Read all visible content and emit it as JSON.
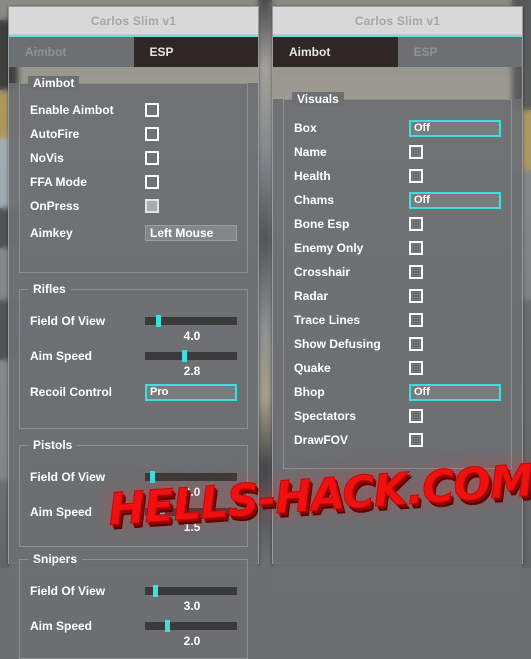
{
  "window_title": "Carlos Slim v1",
  "accent_color": "#3ddede",
  "watermark": "HELLS-HACK.COM",
  "left_window": {
    "title": "Carlos Slim v1",
    "tabs": [
      {
        "label": "Aimbot",
        "active": false
      },
      {
        "label": "ESP",
        "active": true
      }
    ],
    "groups": [
      {
        "legend": "Aimbot",
        "rows": [
          {
            "label": "Enable Aimbot",
            "type": "checkbox",
            "checked": false
          },
          {
            "label": "AutoFire",
            "type": "checkbox",
            "checked": false
          },
          {
            "label": "NoVis",
            "type": "checkbox",
            "checked": false
          },
          {
            "label": "FFA Mode",
            "type": "checkbox",
            "checked": false
          },
          {
            "label": "OnPress",
            "type": "checkbox",
            "checked": true
          },
          {
            "label": "Aimkey",
            "type": "combo-plain",
            "value": "Left Mouse"
          }
        ]
      },
      {
        "legend": "Rifles",
        "rows": [
          {
            "label": "Field Of View",
            "type": "slider",
            "value": "4.0",
            "percent": 12
          },
          {
            "label": "Aim Speed",
            "type": "slider",
            "value": "2.8",
            "percent": 40
          },
          {
            "label": "Recoil Control",
            "type": "combo",
            "value": "Pro"
          }
        ]
      },
      {
        "legend": "Pistols",
        "rows": [
          {
            "label": "Field Of View",
            "type": "slider",
            "value": "2.0",
            "percent": 5
          },
          {
            "label": "Aim Speed",
            "type": "slider",
            "value": "1.5",
            "percent": 16
          }
        ]
      },
      {
        "legend": "Snipers",
        "rows": [
          {
            "label": "Field Of View",
            "type": "slider",
            "value": "3.0",
            "percent": 9
          },
          {
            "label": "Aim Speed",
            "type": "slider",
            "value": "2.0",
            "percent": 22
          }
        ]
      }
    ]
  },
  "right_window": {
    "title": "Carlos Slim v1",
    "tabs": [
      {
        "label": "Aimbot",
        "active": true
      },
      {
        "label": "ESP",
        "active": false
      }
    ],
    "groups": [
      {
        "legend": "Visuals",
        "rows": [
          {
            "label": "Box",
            "type": "combo",
            "value": "Off"
          },
          {
            "label": "Name",
            "type": "checkbox",
            "checked": false
          },
          {
            "label": "Health",
            "type": "checkbox",
            "checked": false
          },
          {
            "label": "Chams",
            "type": "combo",
            "value": "Off"
          },
          {
            "label": "Bone Esp",
            "type": "checkbox",
            "checked": false
          },
          {
            "label": "Enemy Only",
            "type": "checkbox",
            "checked": false
          },
          {
            "label": "Crosshair",
            "type": "checkbox",
            "checked": false
          },
          {
            "label": "Radar",
            "type": "checkbox",
            "checked": false
          },
          {
            "label": "Trace Lines",
            "type": "checkbox",
            "checked": false
          },
          {
            "label": "Show Defusing",
            "type": "checkbox",
            "checked": false
          },
          {
            "label": "Quake",
            "type": "checkbox",
            "checked": false
          },
          {
            "label": "Bhop",
            "type": "combo",
            "value": "Off"
          },
          {
            "label": "Spectators",
            "type": "checkbox",
            "checked": false
          },
          {
            "label": "DrawFOV",
            "type": "checkbox",
            "checked": false
          }
        ]
      }
    ]
  }
}
